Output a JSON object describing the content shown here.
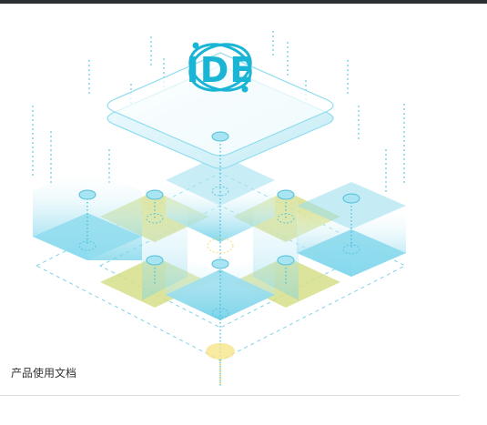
{
  "logo": {
    "text": "IDE",
    "color": "#1ab5d4"
  },
  "footer": {
    "doc_link_label": "产品使用文档"
  },
  "colors": {
    "top_bar": "#2d3033",
    "cyan_block": "#7fd6ea",
    "yellow_tile": "#d6df8a",
    "divider": "#dedede"
  }
}
